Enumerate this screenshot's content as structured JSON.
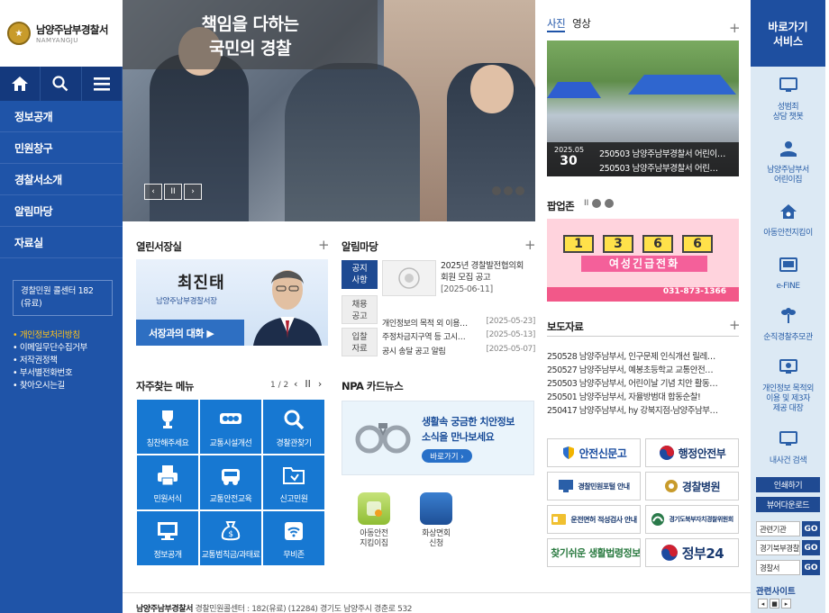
{
  "logo": {
    "name": "남양주남부경찰서",
    "sub": "NAMYANGJU"
  },
  "nav": {
    "items": [
      "정보공개",
      "민원창구",
      "경찰서소개",
      "알림마당",
      "자료실"
    ],
    "call_center": "경찰민원 콜센터 182 (유료)",
    "links": [
      "개인정보처리방침",
      "이메일무단수집거부",
      "저작권정책",
      "부서별전화번호",
      "찾아오시는길"
    ]
  },
  "banner": {
    "line1": "책임을 다하는",
    "line2": "국민의 경찰"
  },
  "ceo": {
    "section": "열린서장실",
    "name": "최진태",
    "title": "남양주남부경찰서장",
    "button": "서장과의 대화 ▶"
  },
  "notice": {
    "section": "알림마당",
    "tabs": [
      {
        "label": "공지\n사항"
      },
      {
        "label": "채용\n공고"
      },
      {
        "label": "입찰\n자료"
      }
    ],
    "featured_title": "2025년 경찰발전협의회 회원 모집 공고",
    "featured_date": "[2025-06-11]",
    "rows": [
      {
        "title": "개인정보의 목적 외 이용…",
        "date": "[2025-05-23]"
      },
      {
        "title": "주정차금지구역 등 고시…",
        "date": "[2025-05-13]"
      },
      {
        "title": "공시 송달 공고 알림",
        "date": "[2025-05-07]"
      }
    ]
  },
  "favorites": {
    "section": "자주찾는 메뉴",
    "page": "1 / 2",
    "items": [
      "칭찬해주세요",
      "교통시설개선",
      "경찰관찾기",
      "민원서식",
      "교통안전교육",
      "신고민원",
      "정보공개",
      "교통범칙금/과태료",
      "무비존"
    ]
  },
  "npa": {
    "section": "NPA 카드뉴스",
    "line1": "생활속 궁금한 치안정보",
    "line2": "소식을 만나보세요",
    "button": "바로가기 ›"
  },
  "apps": [
    {
      "label": "아동안전\n지킴이집"
    },
    {
      "label": "화상면회\n신청"
    }
  ],
  "photo": {
    "tabs": [
      "사진",
      "영상"
    ],
    "year_month": "2025.05",
    "day": "30",
    "caption1": "250503 남양주남부경찰서 어린이…",
    "caption2": "250503 남양주남부경찰서 어린…"
  },
  "popup": {
    "section": "팝업존",
    "digits": [
      "1",
      "3",
      "6",
      "6"
    ],
    "headline": "여성긴급전화",
    "bottom": "031-873-1366"
  },
  "press": {
    "section": "보도자료",
    "items": [
      "250528 남양주남부서, 인구문제 인식개선 릴레…",
      "250527 남양주남부서, 예봉초등학교 교통안전…",
      "250503 남양주남부서, 어린이날 기념 치안 활동…",
      "250501 남양주남부서, 자율방범대 합동순찰!",
      "250417 남양주남부서, hy 강북지점-남양주남부…"
    ]
  },
  "banners": [
    "안전신문고",
    "행정안전부",
    "경찰민원포털 안내",
    "경찰병원",
    "운전면허 적성검사 안내",
    "경기도북부자치경찰위원회",
    "찾기쉬운 생활법령정보",
    "정부24"
  ],
  "services": {
    "header": "바로가기\n서비스",
    "items": [
      "성범죄\n상담 챗봇",
      "남양주남부서\n어린이집",
      "아동안전지킴이",
      "e-FINE",
      "순직경찰추모관",
      "개인정보 목적외\n이용 및 제3자\n제공 대장",
      "내사건 검색"
    ],
    "print": "인쇄하기",
    "viewer": "뷰어다운로드",
    "selects": [
      "관련기관",
      "경기북부경찰",
      "경찰서"
    ],
    "go": "GO",
    "related": "관련사이트"
  },
  "footer": {
    "org": "남양주남부경찰서",
    "info": "경찰민원콜센터 : 182(유료) (12284) 경기도 남양주시 경춘로 532"
  },
  "colors": {
    "nav_blue": "#1f54a8",
    "accent_yellow": "#ffc21a",
    "tile_blue": "#1778d2"
  }
}
